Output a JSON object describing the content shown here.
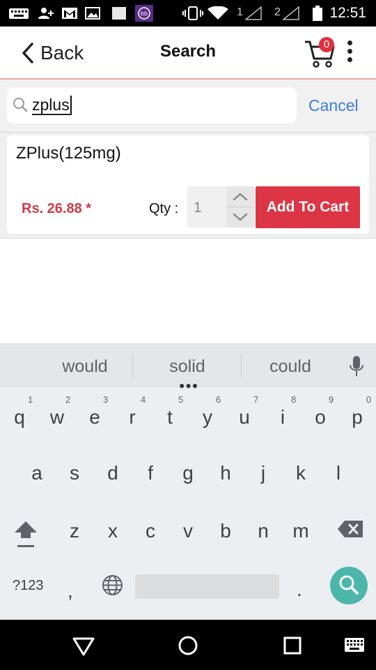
{
  "status_bar": {
    "time": "12:51",
    "sim1_label": "1",
    "sim2_label": "2",
    "icons": [
      "keyboard-icon",
      "add-user-icon",
      "gmail-icon",
      "image-icon",
      "blank-app-icon",
      "bb-app-icon",
      "vibrate-icon",
      "wifi-icon",
      "signal-icon",
      "signal-icon",
      "battery-icon"
    ]
  },
  "app_bar": {
    "back_label": "Back",
    "title": "Search",
    "cart_count": "0"
  },
  "search": {
    "value": "zplus",
    "cancel_label": "Cancel"
  },
  "results": [
    {
      "name": "ZPlus(125mg)",
      "price": "Rs. 26.88 *",
      "qty_label": "Qty :",
      "qty": "1",
      "add_label": "Add To Cart"
    }
  ],
  "keyboard": {
    "suggestions": [
      "would",
      "solid",
      "could"
    ],
    "row1": [
      "q",
      "w",
      "e",
      "r",
      "t",
      "y",
      "u",
      "i",
      "o",
      "p"
    ],
    "row1_hints": [
      "1",
      "2",
      "3",
      "4",
      "5",
      "6",
      "7",
      "8",
      "9",
      "0"
    ],
    "row2": [
      "a",
      "s",
      "d",
      "f",
      "g",
      "h",
      "j",
      "k",
      "l"
    ],
    "row3": [
      "z",
      "x",
      "c",
      "v",
      "b",
      "n",
      "m"
    ],
    "symbols_label": "?123",
    "comma": ",",
    "period": ".",
    "accent_color": "#4db6ac"
  },
  "colors": {
    "price": "#cf3a44",
    "add_button": "#dc3545",
    "cancel": "#3a7cdc",
    "badge": "#e0313f"
  }
}
